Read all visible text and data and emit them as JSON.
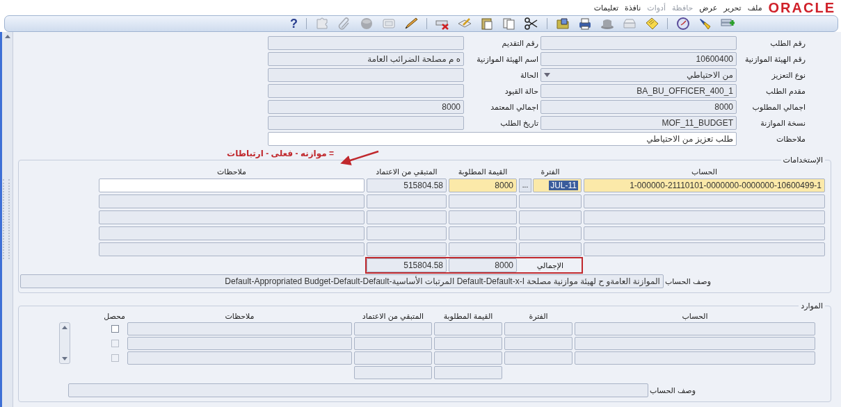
{
  "menubar": {
    "logo": "ORACLE",
    "items": [
      {
        "label": "ملف",
        "disabled": false
      },
      {
        "label": "تحرير",
        "disabled": false
      },
      {
        "label": "عرض",
        "disabled": false
      },
      {
        "label": "حافظة",
        "disabled": true
      },
      {
        "label": "أدوات",
        "disabled": true
      },
      {
        "label": "نافذة",
        "disabled": false
      },
      {
        "label": "تعليمات",
        "disabled": false
      }
    ]
  },
  "toolbar": {
    "help": "?"
  },
  "header": {
    "right_fields": [
      {
        "label": "رقم الطلب",
        "kind": "text"
      },
      {
        "label": "رقم الهيئة الموازنية",
        "value": "10600400",
        "kind": "text"
      },
      {
        "label": "نوع التعزيز",
        "value": "من الاحتياطي",
        "kind": "dropdown"
      },
      {
        "label": "مقدم الطلب",
        "value": "BA_BU_OFFICER_400_1",
        "kind": "text"
      },
      {
        "label": "اجمالي المطلوب",
        "value": "8000",
        "kind": "text"
      },
      {
        "label": "نسخة الموازنة",
        "value": "MOF_11_BUDGET",
        "kind": "text"
      }
    ],
    "left_fields": [
      {
        "label": "رقم التقديم"
      },
      {
        "label": "اسم الهيئة الموازنية",
        "value": "ه م مصلحة الضرائب العامة"
      },
      {
        "label": "الحالة"
      },
      {
        "label": "حالة القيود"
      },
      {
        "label": "اجمالي المعتمد",
        "value": "8000"
      },
      {
        "label": "تاريخ الطلب"
      }
    ],
    "notes": {
      "label": "ملاحظات",
      "value": "طلب تعزيز من الاحتياطي",
      "editable": true
    }
  },
  "uses": {
    "title": "الإستخدامات",
    "annotation": "= موازنه - فعلى - ارتباطات",
    "columns": [
      "الحساب",
      "الفترة",
      "القيمة المطلوبة",
      "المتبقي من الاعتماد",
      "ملاحظات"
    ],
    "rows": [
      {
        "kind": "filled",
        "account": {
          "value": "1-000000-21110101-0000000-0000000-10600499-1",
          "required": true
        },
        "period": {
          "value": "JUL-11",
          "required": true,
          "selected": true
        },
        "lov": "...",
        "amount": {
          "value": "8000",
          "required": true
        },
        "remaining": {
          "value": "515804.58",
          "required": false
        },
        "notes": {
          "editable": true
        }
      },
      {
        "kind": "blank"
      },
      {
        "kind": "blank"
      },
      {
        "kind": "blank"
      },
      {
        "kind": "blank"
      }
    ],
    "totals": {
      "label": "الإجمالي",
      "amount": "8000",
      "remaining": "515804.58",
      "highlighted": true
    },
    "description": {
      "label": "وصف الحساب",
      "value": "الموازنة العامةو ح لهيئة موازنية مصلحة ا-Default-Default-x المرتبات الأساسية-Default-Appropriated Budget-Default-Default"
    }
  },
  "resources": {
    "title": "الموارد",
    "columns": [
      "الحساب",
      "الفترة",
      "القيمة المطلوبة",
      "المتبقي من الاعتماد",
      "ملاحظات",
      "محصل"
    ],
    "rows": [
      {
        "checked": false,
        "disabled": false
      },
      {
        "checked": false,
        "disabled": true
      },
      {
        "checked": false,
        "disabled": true
      }
    ],
    "description": {
      "label": "وصف الحساب"
    }
  }
}
